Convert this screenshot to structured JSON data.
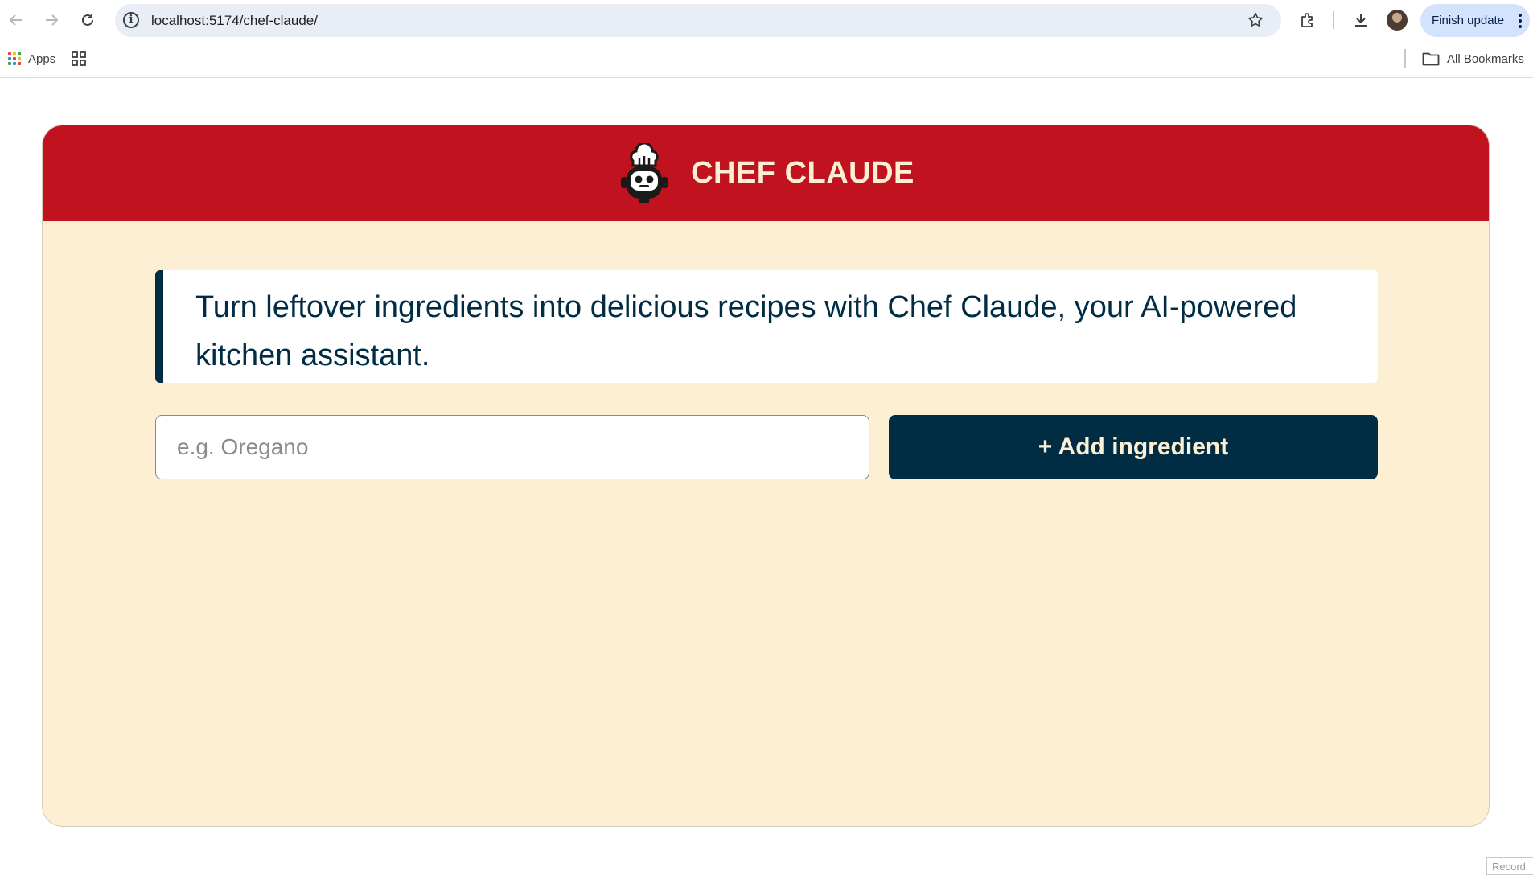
{
  "browser": {
    "url": "localhost:5174/chef-claude/",
    "update_label": "Finish update",
    "bookmarks": {
      "apps_label": "Apps",
      "all_bookmarks_label": "All Bookmarks"
    },
    "icons": [
      "back-arrow-icon",
      "forward-arrow-icon",
      "reload-icon",
      "site-info-icon",
      "bookmark-star-icon",
      "extensions-icon",
      "download-icon",
      "profile-avatar",
      "more-vert-icon",
      "apps-grid-icon",
      "tab-groups-icon",
      "folder-icon"
    ]
  },
  "app": {
    "title": "CHEF CLAUDE",
    "logo_icon": "chef-robot-icon",
    "intro_text": "Turn leftover ingredients into delicious recipes with Chef Claude, your AI-powered kitchen assistant.",
    "ingredient_input": {
      "placeholder": "e.g. Oregano",
      "value": ""
    },
    "add_button_label": "+ Add ingredient",
    "colors": {
      "header_bg": "#c0121f",
      "page_bg": "#fdefd4",
      "accent_dark": "#002d44",
      "title_text": "#fdefd4"
    }
  },
  "overlay": {
    "record_label": "Record"
  }
}
